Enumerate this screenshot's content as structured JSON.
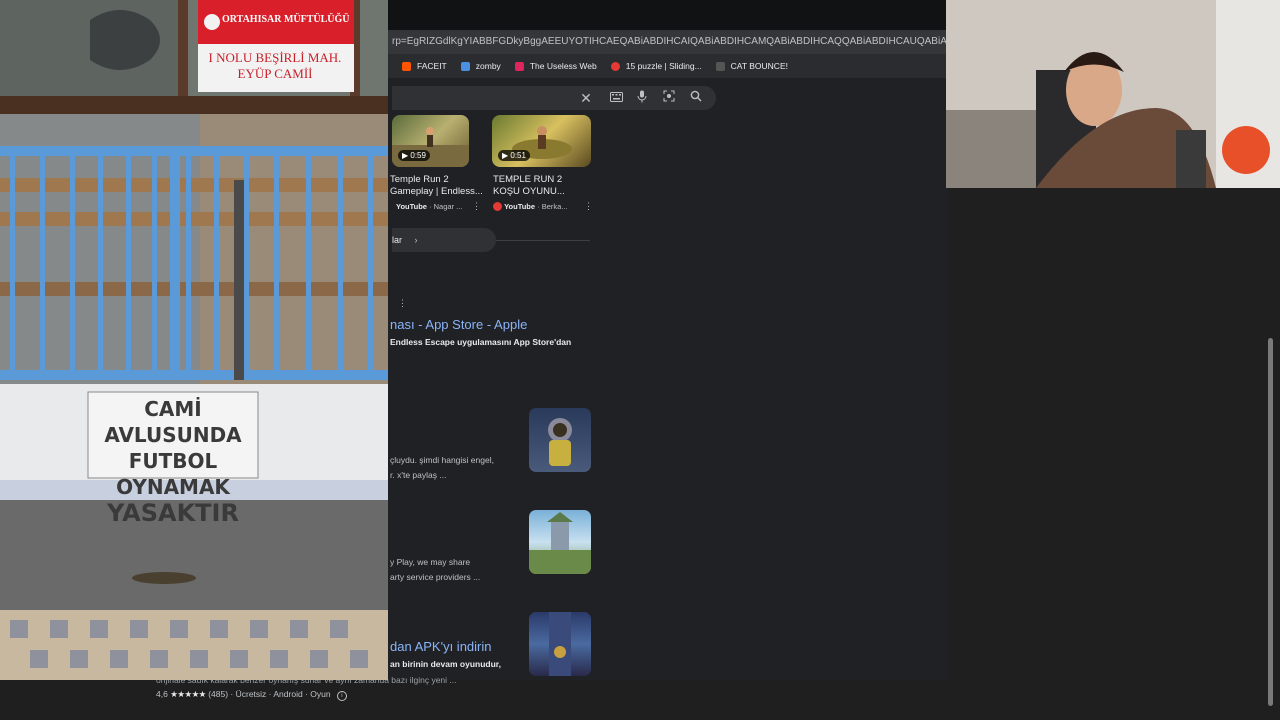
{
  "browser": {
    "url": "rp=EgRIZGdlKgYIABBFGDkyBggAEEUYOTIHCAEQABiABDIHCAIQABiABDIHCAMQABiABDIHCAQQABiABDIHCAUQABiABDIHCAYQABiABD",
    "bookmarks": [
      {
        "label": "FACEIT",
        "color": "#ff5500"
      },
      {
        "label": "zomby",
        "color": "#4a90e2"
      },
      {
        "label": "The Useless Web",
        "color": "#e0245e"
      },
      {
        "label": "15 puzzle | Sliding...",
        "color": "#e53935"
      },
      {
        "label": "CAT BOUNCE!",
        "color": "#555555"
      }
    ]
  },
  "search": {
    "clear_icon": "close-icon",
    "keyboard_icon": "keyboard-icon",
    "mic_icon": "mic-icon",
    "lens_icon": "lens-icon",
    "search_icon": "search-icon"
  },
  "videos": [
    {
      "duration": "0:59",
      "title": "Temple Run 2 Gameplay | Endless...",
      "source": "YouTube",
      "author": "Nagar ..."
    },
    {
      "duration": "0:51",
      "title": "TEMPLE RUN 2 KOŞU OYUNU...",
      "source": "YouTube",
      "author": "Berka..."
    }
  ],
  "more_label": "lar",
  "results": [
    {
      "title": "nası - App Store - Apple",
      "snippet_bold": "Endless Escape uygulamasını App Store'dan"
    },
    {
      "snippet1": "çluydu. şimdi hangisi engel,",
      "snippet2": "r. x'te paylaş ..."
    },
    {
      "snippet1": "y Play, we may share",
      "snippet2": "arty service providers ..."
    },
    {
      "title": "dan APK'yı indirin",
      "snippet_bold": "an birinin devam oyunudur,",
      "snippet2": "orijinale sadık kalarak benzer oynanış sunar ve aynı zamanda bazı ilginç yeni ..."
    }
  ],
  "rating": {
    "score": "4,6",
    "stars": "★★★★★",
    "count": "(485)",
    "price": "Ücretsiz",
    "platform": "Android",
    "category": "Oyun"
  },
  "overlay": {
    "sign_header": "ORTAHISAR MÜFTÜLÜĞÜ",
    "sign_line1": "I NOLU BEŞİRLİ MAH.",
    "sign_line2": "EYÜP CAMİİ",
    "notice_line1": "CAMİ AVLUSUNDA",
    "notice_line2": "FUTBOL OYNAMAK",
    "notice_line3": "YASAKTIR"
  }
}
